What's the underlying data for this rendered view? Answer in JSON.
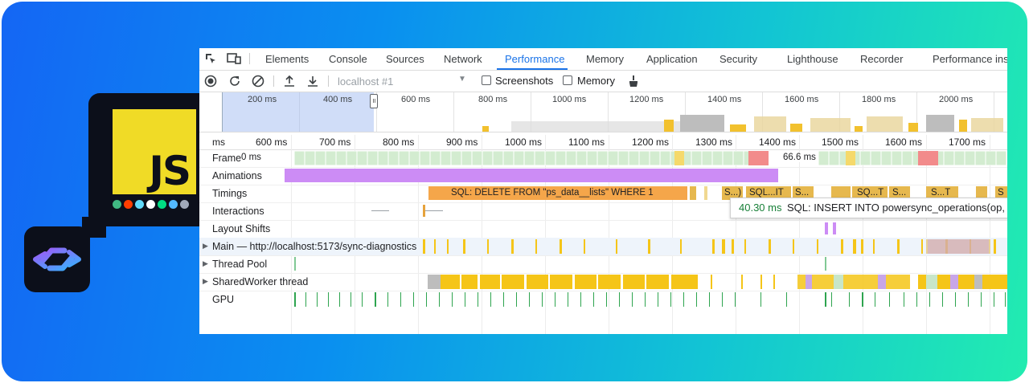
{
  "devtools": {
    "tabs": [
      "Elements",
      "Console",
      "Sources",
      "Network",
      "Performance",
      "Memory",
      "Application",
      "Security",
      "Lighthouse",
      "Recorder",
      "Performance insights"
    ],
    "active_tab": "Performance",
    "toolbar": {
      "profile": "localhost #1",
      "screenshots_label": "Screenshots",
      "memory_label": "Memory"
    },
    "overview_ticks": [
      "200 ms",
      "400 ms",
      "600 ms",
      "800 ms",
      "1000 ms",
      "1200 ms",
      "1400 ms",
      "1600 ms",
      "1800 ms",
      "2000 ms"
    ],
    "ruler_ticks": [
      "ms",
      "600 ms",
      "700 ms",
      "800 ms",
      "900 ms",
      "1000 ms",
      "1100 ms",
      "1200 ms",
      "1300 ms",
      "1400 ms",
      "1500 ms",
      "1600 ms",
      "1700 ms"
    ],
    "tracks": {
      "frames": "Frames",
      "animations": "Animations",
      "timings": "Timings",
      "interactions": "Interactions",
      "layout_shifts": "Layout Shifts",
      "main": "Main — http://localhost:5173/sync-diagnostics",
      "thread_pool": "Thread Pool",
      "shared_worker": "SharedWorker thread",
      "gpu": "GPU"
    },
    "frame_labels": {
      "a": "0 ms",
      "b": "66.6 ms"
    },
    "timing_labels": {
      "main": "SQL: DELETE FROM \"ps_data__lists\" WHERE 1",
      "s1": "S...)",
      "s2": "SQL...IT",
      "s3": "S...",
      "s4": "SQ...T",
      "s5": "S...",
      "s6": "S...T",
      "s7": "S"
    },
    "tooltip": {
      "duration": "40.30 ms",
      "text": "SQL: INSERT INTO powersync_operations(op, d"
    }
  },
  "badges": {
    "js_logo_text": "JS",
    "framework_icons": [
      "vue-icon",
      "svelte-icon",
      "react-icon",
      "next-icon",
      "nuxt-icon",
      "capacitor-icon",
      "settings-icon"
    ]
  },
  "colors": {
    "timing_orange": "#f5a64a",
    "timing_gold": "#e6b84e",
    "animation_purple": "#cc8cf5",
    "frame_green": "#d3ecd0",
    "frame_red": "#f28b8b",
    "gpu_green": "#2ea44f",
    "script_yellow": "#f5c518",
    "tooltip_green": "#188038"
  }
}
